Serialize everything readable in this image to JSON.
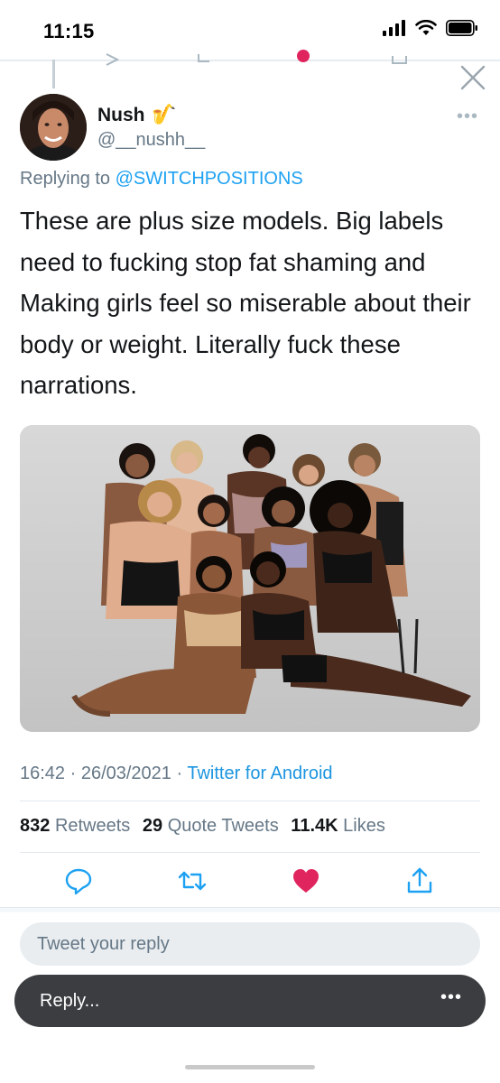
{
  "status_bar": {
    "time": "11:15"
  },
  "tweet": {
    "author": {
      "name": "Nush",
      "emoji": "🎷",
      "handle": "@__nushh__"
    },
    "replying_to": {
      "prefix": "Replying to ",
      "mention": "@SWITCHPOSITIONS"
    },
    "text": "These are plus size models. Big labels need to fucking stop fat shaming and Making girls feel so miserable about their body or weight. Literally fuck these narrations.",
    "timestamp": "16:42 · 26/03/2021 · ",
    "source": "Twitter for Android",
    "stats": {
      "retweets_count": "832",
      "retweets_label": "Retweets",
      "quotes_count": "29",
      "quotes_label": "Quote Tweets",
      "likes_count": "11.4K",
      "likes_label": "Likes"
    }
  },
  "reply_box": {
    "placeholder": "Tweet your reply"
  },
  "toast": {
    "label": "Reply...",
    "more": "•••"
  },
  "icons": {
    "reply": "reply-icon",
    "retweet": "retweet-icon",
    "like": "heart-icon",
    "share": "share-icon",
    "close": "close-icon",
    "more": "more-icon"
  },
  "colors": {
    "link": "#1da1f2",
    "like": "#e0245e",
    "secondary_text": "#657786"
  }
}
